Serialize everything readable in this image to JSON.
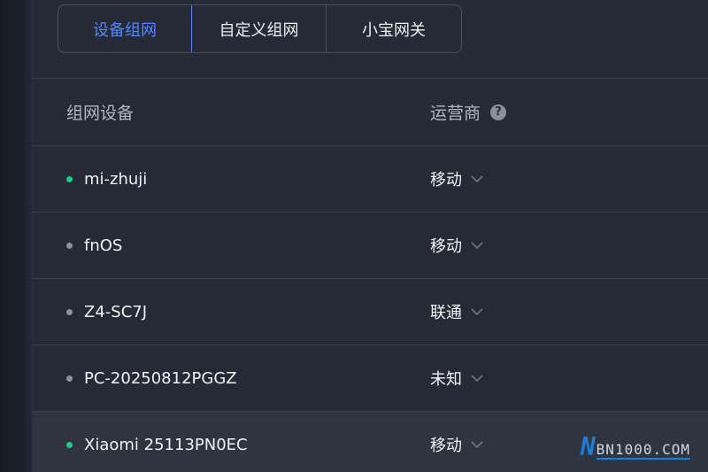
{
  "tabs": [
    {
      "label": "设备组网",
      "active": true
    },
    {
      "label": "自定义组网",
      "active": false
    },
    {
      "label": "小宝网关",
      "active": false
    }
  ],
  "table": {
    "headers": {
      "device": "组网设备",
      "carrier": "运营商"
    },
    "rows": [
      {
        "name": "mi-zhuji",
        "status": "online",
        "carrier": "移动"
      },
      {
        "name": "fnOS",
        "status": "offline",
        "carrier": "移动"
      },
      {
        "name": "Z4-SC7J",
        "status": "offline",
        "carrier": "联通"
      },
      {
        "name": "PC-20250812PGGZ",
        "status": "offline",
        "carrier": "未知"
      },
      {
        "name": "Xiaomi 25113PN0EC",
        "status": "online",
        "carrier": "移动"
      }
    ]
  },
  "colors": {
    "online": "#1fc98a",
    "offline": "#8d919c",
    "accent": "#4f86ff"
  },
  "icons": {
    "help": "question-circle-icon",
    "dropdown": "chevron-down-icon"
  },
  "watermark": {
    "logo": "N",
    "text": "BN1000.COM"
  }
}
